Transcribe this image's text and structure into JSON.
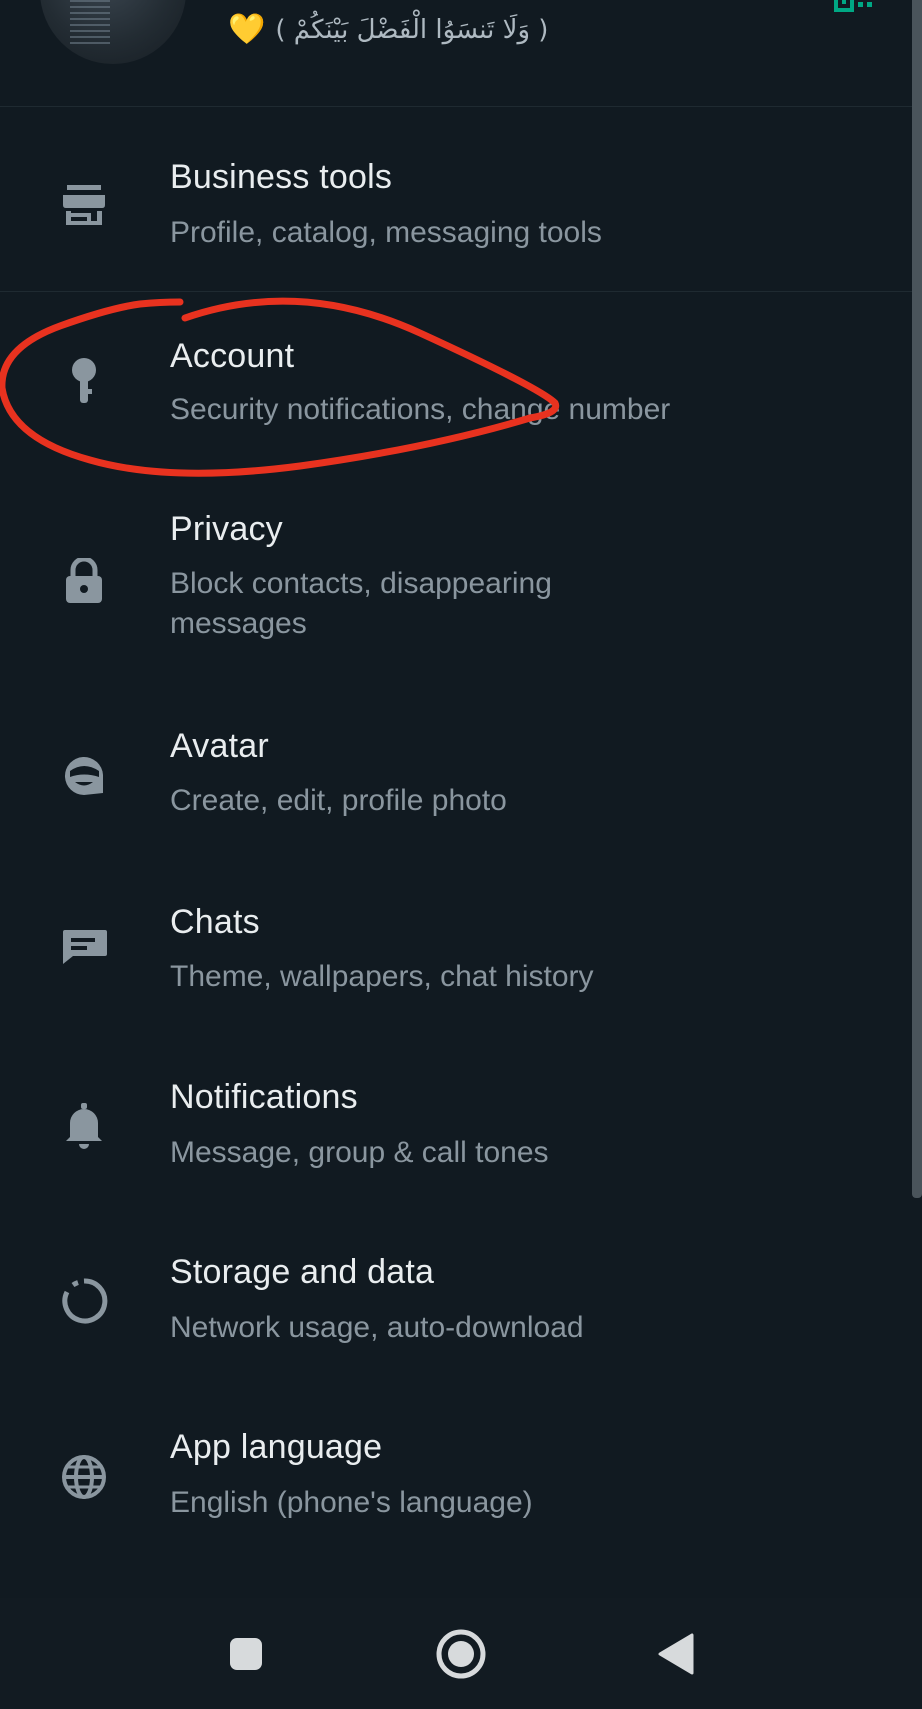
{
  "profile": {
    "status_heart": "💛",
    "status_text": "( وَلَا تَنسَوُا الْفَضْلَ بَيْنَكُمْ )"
  },
  "settings": [
    {
      "icon": "storefront-icon",
      "title": "Business tools",
      "subtitle": "Profile, catalog, messaging tools"
    },
    {
      "icon": "key-icon",
      "title": "Account",
      "subtitle": "Security notifications, change number"
    },
    {
      "icon": "lock-icon",
      "title": "Privacy",
      "subtitle": "Block contacts, disappearing",
      "subtitle2": "messages"
    },
    {
      "icon": "avatar-face-icon",
      "title": "Avatar",
      "subtitle": "Create, edit, profile photo"
    },
    {
      "icon": "chat-icon",
      "title": "Chats",
      "subtitle": "Theme, wallpapers, chat history"
    },
    {
      "icon": "bell-icon",
      "title": "Notifications",
      "subtitle": "Message, group & call tones"
    },
    {
      "icon": "storage-circle-icon",
      "title": "Storage and data",
      "subtitle": "Network usage, auto-download"
    },
    {
      "icon": "globe-icon",
      "title": "App language",
      "subtitle": "English (phone's language)"
    }
  ],
  "annotation": {
    "color": "#e8321f",
    "highlighted_item": "Account"
  },
  "colors": {
    "background": "#111a21",
    "title_text": "#e9edef",
    "subtitle_text": "#8a969f",
    "icon": "#8a969f",
    "accent": "#00a884"
  },
  "navbar": {
    "buttons": [
      "recent-apps-icon",
      "home-icon",
      "back-icon"
    ]
  }
}
